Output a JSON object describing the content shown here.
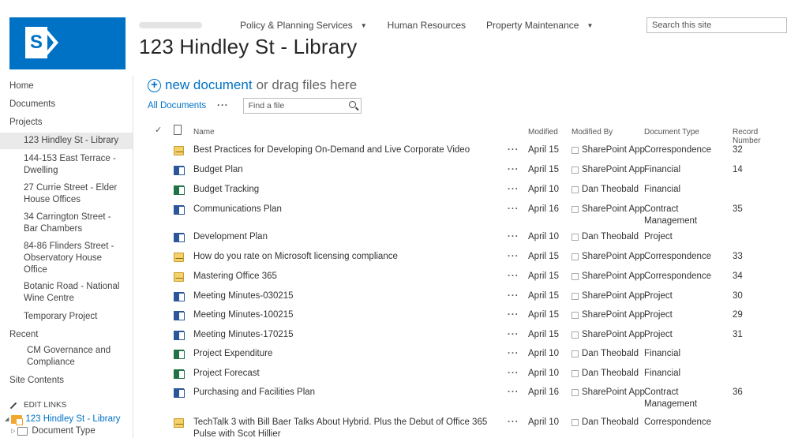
{
  "app": {
    "site_name_blurred": "Adelaide City Council",
    "page_title": "123 Hindley St - Library"
  },
  "topnav": {
    "items": [
      {
        "label": "Policy & Planning Services",
        "has_dropdown": true
      },
      {
        "label": "Human Resources",
        "has_dropdown": false
      },
      {
        "label": "Property Maintenance",
        "has_dropdown": true
      }
    ],
    "search_placeholder": "Search this site"
  },
  "leftnav": {
    "home": "Home",
    "documents": "Documents",
    "projects": "Projects",
    "project_items": [
      {
        "label": "123 Hindley St - Library",
        "selected": true
      },
      {
        "label": "144-153 East Terrace - Dwelling"
      },
      {
        "label": "27 Currie Street - Elder House Offices"
      },
      {
        "label": "34 Carrington Street - Bar Chambers"
      },
      {
        "label": "84-86 Flinders Street -Observatory House Office"
      },
      {
        "label": "Botanic Road - National Wine Centre"
      },
      {
        "label": "Temporary Project"
      }
    ],
    "recent": "Recent",
    "recent_items": [
      {
        "label": "CM Governance and Compliance"
      }
    ],
    "site_contents": "Site Contents",
    "edit_links": "EDIT LINKS",
    "tree_library": "123 Hindley St - Library",
    "tree_doctype": "Document Type"
  },
  "commands": {
    "new_document": "new document",
    "drag_text": "or drag files here",
    "view_current": "All Documents",
    "view_more": "···",
    "find_placeholder": "Find a file"
  },
  "table": {
    "headers": {
      "name": "Name",
      "modified": "Modified",
      "modified_by": "Modified By",
      "doc_type": "Document Type",
      "record_number": "Record Number"
    },
    "rows": [
      {
        "icon": "mail",
        "name": "Best Practices for Developing On-Demand and Live Corporate Video",
        "modified": "April 15",
        "by": "SharePoint App",
        "type": "Correspondence",
        "record": "32"
      },
      {
        "icon": "word",
        "name": "Budget Plan",
        "modified": "April 15",
        "by": "SharePoint App",
        "type": "Financial",
        "record": "14"
      },
      {
        "icon": "excel",
        "name": "Budget Tracking",
        "modified": "April 10",
        "by": "Dan Theobald",
        "type": "Financial",
        "record": ""
      },
      {
        "icon": "word",
        "name": "Communications Plan",
        "modified": "April 16",
        "by": "SharePoint App",
        "type": "Contract Management",
        "record": "35"
      },
      {
        "icon": "word",
        "name": "Development Plan",
        "modified": "April 10",
        "by": "Dan Theobald",
        "type": "Project",
        "record": ""
      },
      {
        "icon": "mail",
        "name": "How do you rate on Microsoft licensing compliance",
        "modified": "April 15",
        "by": "SharePoint App",
        "type": "Correspondence",
        "record": "33"
      },
      {
        "icon": "mail",
        "name": "Mastering Office 365",
        "modified": "April 15",
        "by": "SharePoint App",
        "type": "Correspondence",
        "record": "34"
      },
      {
        "icon": "onenote",
        "name": "Meeting Minutes-030215",
        "modified": "April 15",
        "by": "SharePoint App",
        "type": "Project",
        "record": "30"
      },
      {
        "icon": "onenote",
        "name": "Meeting Minutes-100215",
        "modified": "April 15",
        "by": "SharePoint App",
        "type": "Project",
        "record": "29"
      },
      {
        "icon": "onenote",
        "name": "Meeting Minutes-170215",
        "modified": "April 15",
        "by": "SharePoint App",
        "type": "Project",
        "record": "31"
      },
      {
        "icon": "excel",
        "name": "Project Expenditure",
        "modified": "April 10",
        "by": "Dan Theobald",
        "type": "Financial",
        "record": ""
      },
      {
        "icon": "excel",
        "name": "Project Forecast",
        "modified": "April 10",
        "by": "Dan Theobald",
        "type": "Financial",
        "record": ""
      },
      {
        "icon": "word",
        "name": "Purchasing and Facilities Plan",
        "modified": "April 16",
        "by": "SharePoint App",
        "type": "Contract Management",
        "record": "36"
      },
      {
        "icon": "mail",
        "name": "TechTalk 3 with Bill Baer Talks About Hybrid. Plus the Debut of Office 365 Pulse with Scot Hillier",
        "modified": "April 10",
        "by": "Dan Theobald",
        "type": "Correspondence",
        "record": ""
      }
    ]
  }
}
